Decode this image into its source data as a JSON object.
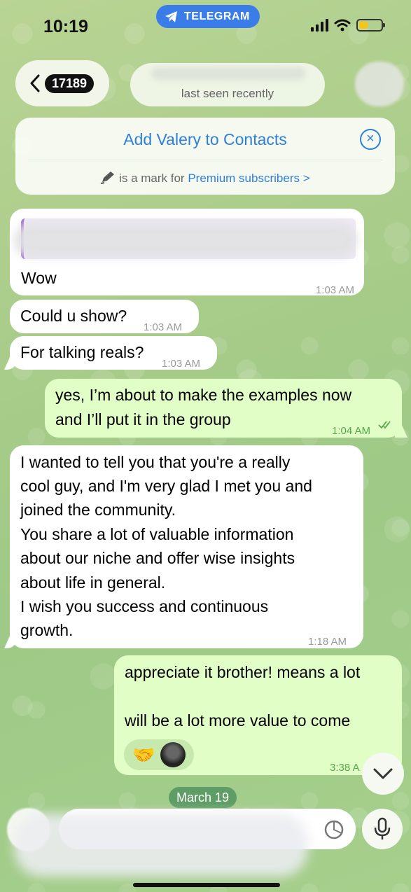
{
  "status_bar": {
    "time": "10:19",
    "app_pill": "TELEGRAM"
  },
  "header": {
    "unread_count": "17189",
    "status": "last seen recently"
  },
  "banner": {
    "title": "Add Valery to Contacts",
    "sub_text": "is a mark for",
    "sub_link": "Premium subscribers",
    "sub_chevron": ">"
  },
  "messages": [
    {
      "dir": "in",
      "text": "Wow",
      "time": "1:03 AM"
    },
    {
      "dir": "in",
      "text": "Could u show?",
      "time": "1:03 AM"
    },
    {
      "dir": "in",
      "text": "For talking reals?",
      "time": "1:03 AM"
    },
    {
      "dir": "out",
      "lines": [
        "yes, I’m about to make the examples now",
        "and I’ll put it in the group"
      ],
      "time": "1:04 AM",
      "read": true
    },
    {
      "dir": "in",
      "lines": [
        "I wanted to tell you that you're a really",
        "cool guy, and I'm very glad I met you and",
        "joined the community.",
        "You share a lot of valuable information",
        "about our niche and offer wise insights",
        "about life in general.",
        "I wish you success and continuous",
        "growth."
      ],
      "time": "1:18 AM"
    },
    {
      "dir": "out",
      "lines": [
        "appreciate it brother! means a lot",
        "",
        "will be a lot more value to come"
      ],
      "time": "3:38 A",
      "reaction": "handshake"
    }
  ],
  "date_separator": "March 19",
  "icons": [
    "telegram-icon",
    "signal-icon",
    "wifi-icon",
    "battery-icon",
    "back-chevron-icon",
    "close-circle-icon",
    "pen-icon",
    "double-check-icon",
    "handshake-icon",
    "chevron-down-icon",
    "clock-icon",
    "mic-icon"
  ],
  "colors": {
    "accent": "#2f7fd9",
    "outgoing_bubble": "#e1fec6",
    "incoming_bubble": "#ffffff",
    "date_pill": "#5f9d66"
  }
}
